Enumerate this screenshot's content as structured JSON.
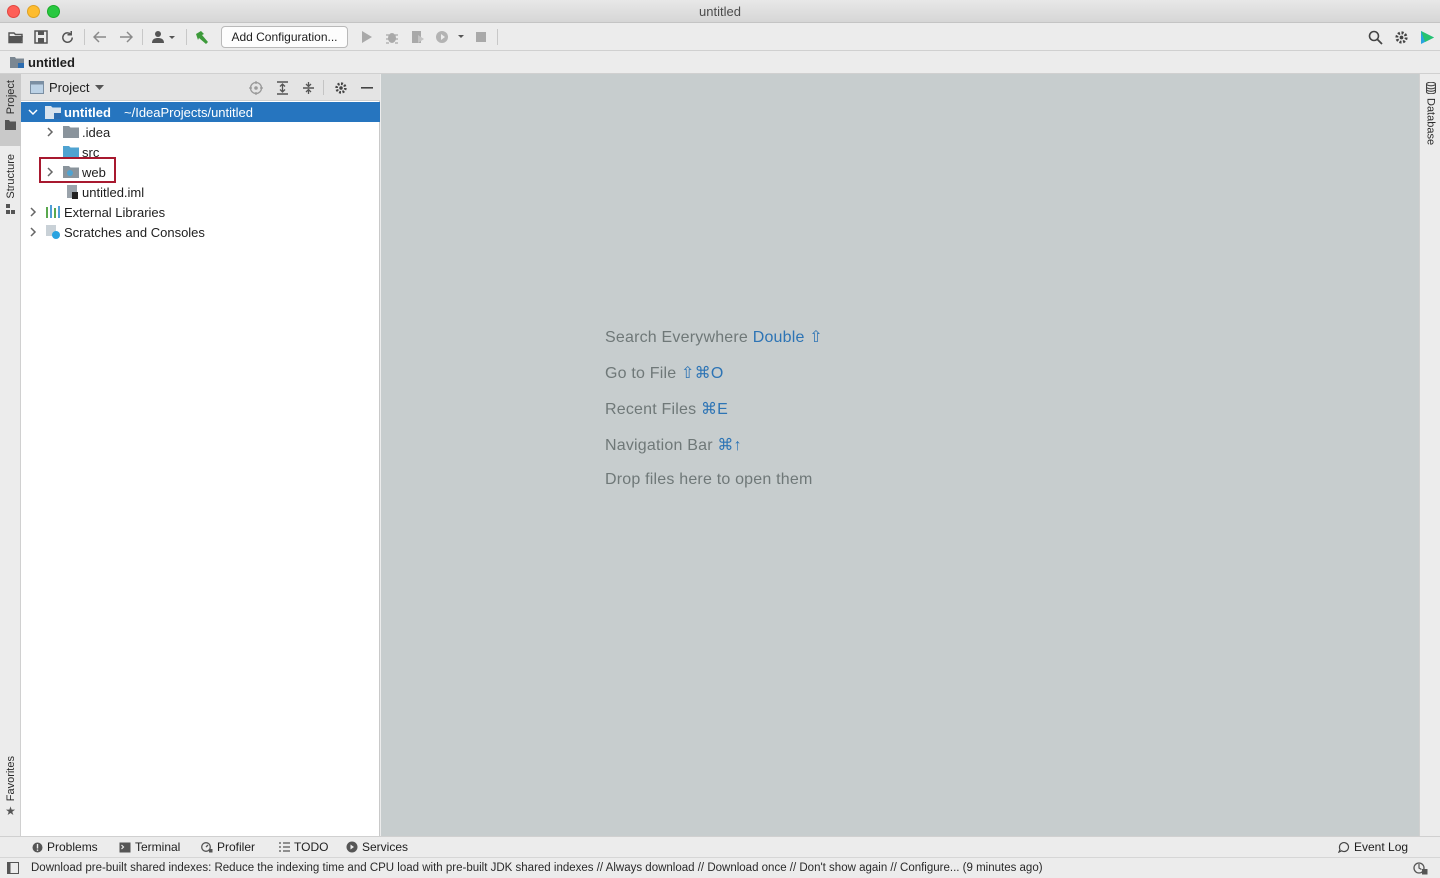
{
  "window": {
    "title": "untitled"
  },
  "toolbar": {
    "add_configuration_label": "Add Configuration..."
  },
  "navbar": {
    "project_label": "untitled"
  },
  "left_stripe": {
    "project_tab": "Project",
    "structure_tab": "Structure",
    "favorites_tab": "Favorites"
  },
  "right_stripe": {
    "database_tab": "Database"
  },
  "project_panel": {
    "view_label": "Project",
    "tree": [
      {
        "name": "untitled",
        "path": "~/IdeaProjects/untitled"
      },
      {
        "name": ".idea"
      },
      {
        "name": "src"
      },
      {
        "name": "web"
      },
      {
        "name": "untitled.iml"
      },
      {
        "name": "External Libraries"
      },
      {
        "name": "Scratches and Consoles"
      }
    ]
  },
  "editor": {
    "hints": [
      {
        "text": "Search Everywhere",
        "key": "Double ⇧"
      },
      {
        "text": "Go to File",
        "key": "⇧⌘O"
      },
      {
        "text": "Recent Files",
        "key": "⌘E"
      },
      {
        "text": "Navigation Bar",
        "key": "⌘↑"
      },
      {
        "text": "Drop files here to open them",
        "key": ""
      }
    ]
  },
  "bottom_bar": {
    "problems": "Problems",
    "terminal": "Terminal",
    "profiler": "Profiler",
    "todo": "TODO",
    "services": "Services",
    "event_log": "Event Log"
  },
  "status_bar": {
    "message": "Download pre-built shared indexes: Reduce the indexing time and CPU load with pre-built JDK shared indexes // Always download // Download once // Don't show again // Configure... (9 minutes ago)"
  },
  "colors": {
    "selection": "#2675bf",
    "editor_bg": "#c7cdce",
    "hint_key": "#2d74b5",
    "highlight_border": "#a8192f"
  }
}
